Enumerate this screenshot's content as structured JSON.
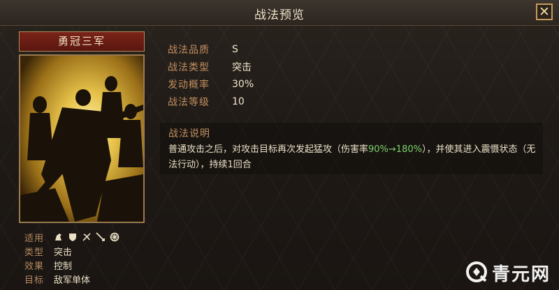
{
  "window": {
    "title": "战法预览",
    "close_label": "✕"
  },
  "card": {
    "name": "勇冠三军"
  },
  "attributes": {
    "applicable_label": "适用",
    "applicable_icons": [
      "cavalry-icon",
      "shield-icon",
      "bow-icon",
      "spear-icon",
      "chariot-icon"
    ],
    "type_label": "类型",
    "type_value": "突击",
    "effect_label": "效果",
    "effect_value": "控制",
    "target_label": "目标",
    "target_value": "敌军单体"
  },
  "info": {
    "quality_label": "战法品质",
    "quality_value": "S",
    "type_label": "战法类型",
    "type_value": "突击",
    "rate_label": "发动概率",
    "rate_value": "30%",
    "level_label": "战法等级",
    "level_value": "10"
  },
  "description": {
    "title": "战法说明",
    "text_before": "普通攻击之后，对攻击目标再次发起猛攻（伤害率",
    "highlight": "90%→180%",
    "text_after": "），并使其进入震慑状态（无法行动），持续1回合"
  },
  "watermark": {
    "text": "青元网"
  },
  "colors": {
    "accent_gold": "#c28f5f",
    "highlight_green": "#7ed36a",
    "card_header_red": "#7a2418"
  }
}
